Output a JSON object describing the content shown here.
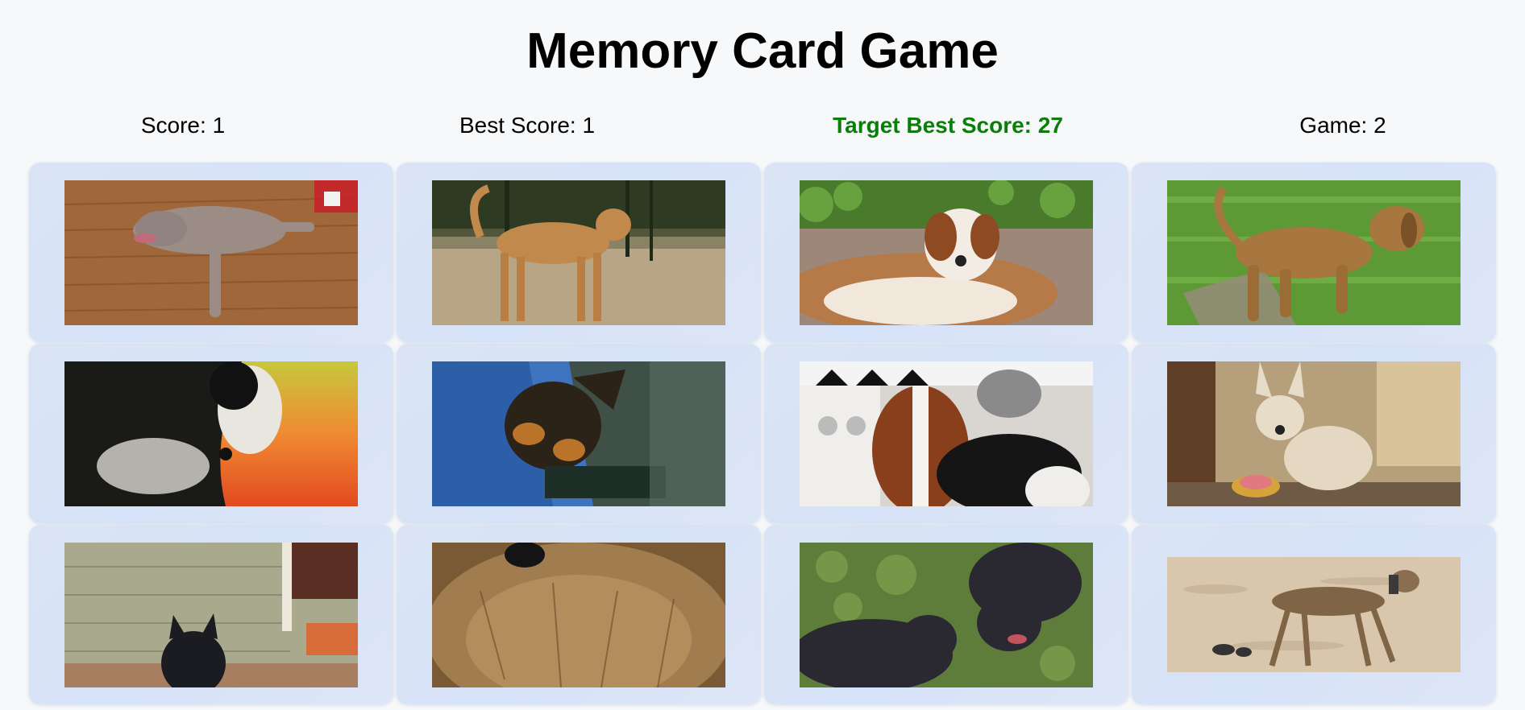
{
  "title": "Memory Card Game",
  "stats": {
    "score": "Score: 1",
    "best_score": "Best Score: 1",
    "target_best_score": "Target Best Score: 27",
    "game": "Game: 2",
    "target_color": "#0a7d0a"
  },
  "cards": [
    {
      "picture": "weimaraner lying on wooden floor",
      "bg": "#a0673b",
      "dog": "#9b8d86"
    },
    {
      "picture": "tan dog standing in dirt yard",
      "bg": "#b8a586",
      "dog": "#c2894c"
    },
    {
      "picture": "saint bernard lying by fence with ivy",
      "bg": "#9c8778",
      "dog": "#b67a48"
    },
    {
      "picture": "brown puppy walking on grass",
      "bg": "#5d9a35",
      "dog": "#a8773f"
    },
    {
      "picture": "black and white dog by orange fabric",
      "bg": "#1a1a16",
      "dog": "#e2833a"
    },
    {
      "picture": "black and tan puppy held in blue sleeve",
      "bg": "#2d5fa8",
      "dog": "#2b2218"
    },
    {
      "picture": "basset hound by a stove",
      "bg": "#d9d6d2",
      "dog": "#8a3f1c"
    },
    {
      "picture": "small cream dog sitting on rug",
      "bg": "#6e5a45",
      "dog": "#e4d8c2"
    },
    {
      "picture": "black fluffy dog on porch",
      "bg": "#a9a98e",
      "dog": "#1b1c22"
    },
    {
      "picture": "close-up of fluffy brown terrier face",
      "bg": "#7a5a35",
      "dog": "#a07c4f"
    },
    {
      "picture": "two dark pit bull puppies on grass",
      "bg": "#5e7d3b",
      "dog": "#2a2830"
    },
    {
      "picture": "greyhound walking on sandy beach",
      "bg": "#d8c7ac",
      "dog": "#806446"
    }
  ]
}
